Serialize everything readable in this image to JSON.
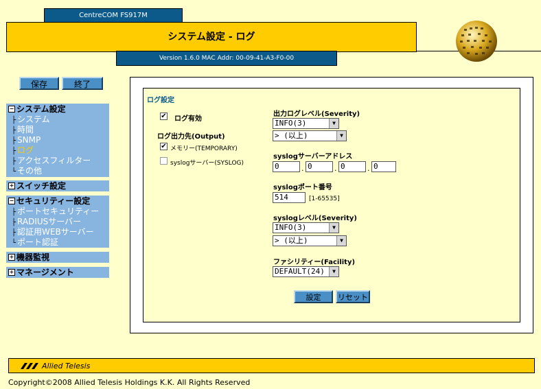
{
  "header": {
    "product": "CentreCOM FS917M",
    "title": "システム設定 - ログ",
    "version": "Version 1.6.0 MAC Addr: 00-09-41-A3-F0-00"
  },
  "top_buttons": {
    "save": "保存",
    "end": "終了"
  },
  "sidebar": {
    "system": {
      "label": "システム設定",
      "items": [
        "システム",
        "時間",
        "SNMP",
        "ログ",
        "アクセスフィルター",
        "その他"
      ],
      "active": "ログ"
    },
    "switch": {
      "label": "スイッチ設定"
    },
    "security": {
      "label": "セキュリティー設定",
      "items": [
        "ポートセキュリティー",
        "RADIUSサーバー",
        "認証用WEBサーバー",
        "ポート認証"
      ]
    },
    "monitor": {
      "label": "機器監視"
    },
    "management": {
      "label": "マネージメント"
    }
  },
  "form": {
    "section_title": "ログ設定",
    "log_enable": {
      "label": "ログ有効",
      "checked": true
    },
    "output_dest_label": "ログ出力先(Output)",
    "memory": {
      "label": "メモリー(TEMPORARY)",
      "checked": true
    },
    "syslog_server_opt": {
      "label": "syslogサーバー(SYSLOG)",
      "checked": false
    },
    "output_level": {
      "label": "出力ログレベル(Severity)",
      "value": "INFO(3)",
      "mode": "> (以上)"
    },
    "syslog_address": {
      "label": "syslogサーバーアドレス",
      "octets": [
        "0",
        "0",
        "0",
        "0"
      ]
    },
    "syslog_port": {
      "label": "syslogポート番号",
      "value": "514",
      "range": "[1-65535]"
    },
    "syslog_level": {
      "label": "syslogレベル(Severity)",
      "value": "INFO(3)",
      "mode": "> (以上)"
    },
    "facility": {
      "label": "ファシリティー(Facility)",
      "value": "DEFAULT(24)"
    },
    "buttons": {
      "apply": "設定",
      "reset": "リセット"
    }
  },
  "footer": {
    "brand": "Allied Telesis",
    "copyright": "Copyright©2008 Allied Telesis Holdings K.K. All Rights Reserved"
  }
}
